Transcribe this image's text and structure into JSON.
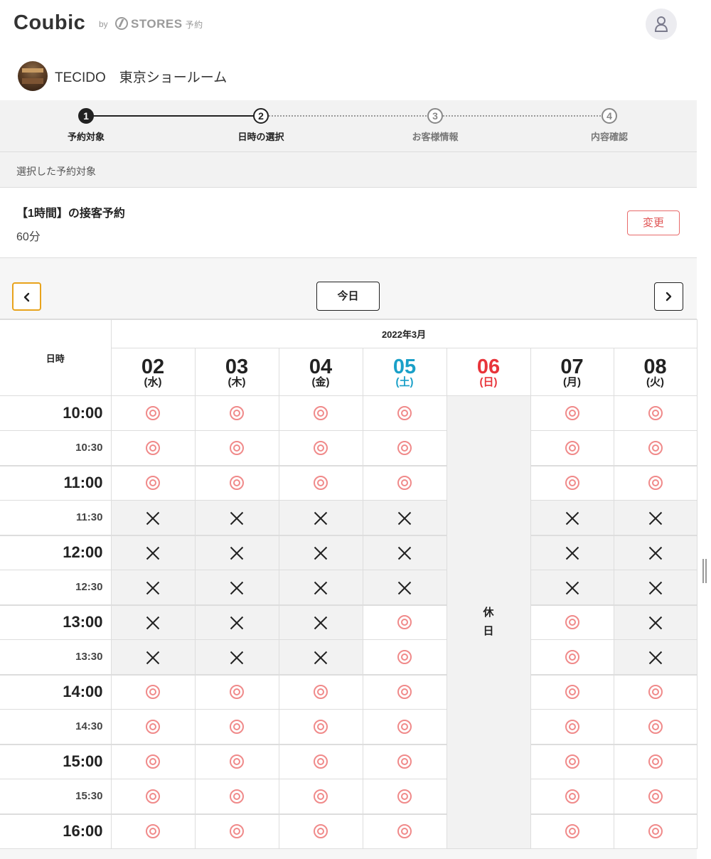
{
  "header": {
    "logo": "Coubic",
    "by": "by",
    "stores": "STORES",
    "stores_sub": "予約",
    "user_icon": "user-icon"
  },
  "shop": {
    "name": "TECIDO　東京ショールーム"
  },
  "steps": [
    {
      "num": "1",
      "label": "予約対象",
      "state": "done"
    },
    {
      "num": "2",
      "label": "日時の選択",
      "state": "current"
    },
    {
      "num": "3",
      "label": "お客様情報",
      "state": "future"
    },
    {
      "num": "4",
      "label": "内容確認",
      "state": "future"
    }
  ],
  "selected": {
    "header": "選択した予約対象",
    "title": "【1時間】の接客予約",
    "duration": "60分",
    "change_label": "変更"
  },
  "calendar": {
    "today_label": "今日",
    "prev_icon": "chevron-left-icon",
    "next_icon": "chevron-right-icon",
    "datetime_label": "日時",
    "month": "2022年3月",
    "days": [
      {
        "num": "02",
        "weekday": "(水)",
        "color": "black"
      },
      {
        "num": "03",
        "weekday": "(木)",
        "color": "black"
      },
      {
        "num": "04",
        "weekday": "(金)",
        "color": "black"
      },
      {
        "num": "05",
        "weekday": "(土)",
        "color": "blue"
      },
      {
        "num": "06",
        "weekday": "(日)",
        "color": "red"
      },
      {
        "num": "07",
        "weekday": "(月)",
        "color": "black"
      },
      {
        "num": "08",
        "weekday": "(火)",
        "color": "black"
      }
    ],
    "holiday_label": "休\n日",
    "holiday_day_index": 4,
    "times": [
      "10:00",
      "10:30",
      "11:00",
      "11:30",
      "12:00",
      "12:30",
      "13:00",
      "13:30",
      "14:00",
      "14:30",
      "15:00",
      "15:30",
      "16:00"
    ],
    "slots": [
      [
        "o",
        "o",
        "o",
        "o",
        "h",
        "o",
        "o"
      ],
      [
        "o",
        "o",
        "o",
        "o",
        "h",
        "o",
        "o"
      ],
      [
        "o",
        "o",
        "o",
        "o",
        "h",
        "o",
        "o"
      ],
      [
        "x",
        "x",
        "x",
        "x",
        "h",
        "x",
        "x"
      ],
      [
        "x",
        "x",
        "x",
        "x",
        "h",
        "x",
        "x"
      ],
      [
        "x",
        "x",
        "x",
        "x",
        "h",
        "x",
        "x"
      ],
      [
        "x",
        "x",
        "x",
        "o",
        "h",
        "o",
        "x"
      ],
      [
        "x",
        "x",
        "x",
        "o",
        "h",
        "o",
        "x"
      ],
      [
        "o",
        "o",
        "o",
        "o",
        "h",
        "o",
        "o"
      ],
      [
        "o",
        "o",
        "o",
        "o",
        "h",
        "o",
        "o"
      ],
      [
        "o",
        "o",
        "o",
        "o",
        "h",
        "o",
        "o"
      ],
      [
        "o",
        "o",
        "o",
        "o",
        "h",
        "o",
        "o"
      ],
      [
        "o",
        "o",
        "o",
        "o",
        "h",
        "o",
        "o"
      ]
    ],
    "slot_legend": {
      "o": "available",
      "x": "unavailable",
      "h": "holiday"
    }
  },
  "colors": {
    "accent_red": "#e05555",
    "saturday_blue": "#1aa0c8",
    "sunday_red": "#e8343a",
    "focus_orange": "#e8a31c"
  }
}
